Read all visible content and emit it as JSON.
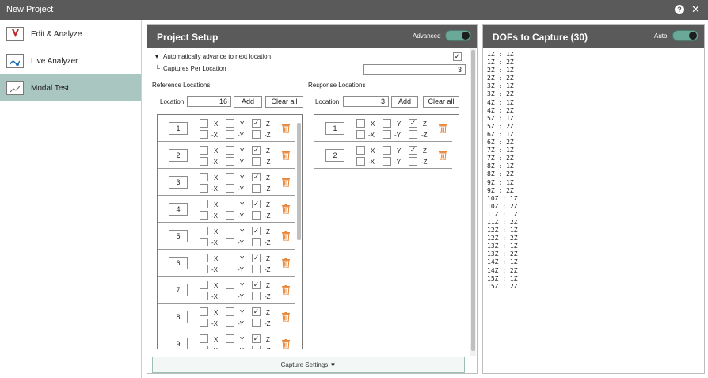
{
  "window": {
    "title": "New Project",
    "help_label": "?",
    "close_label": "✕"
  },
  "nav": {
    "items": [
      {
        "label": "Edit & Analyze",
        "icon": "edit-analyze-icon",
        "active": false
      },
      {
        "label": "Live Analyzer",
        "icon": "live-analyzer-icon",
        "active": false
      },
      {
        "label": "Modal Test",
        "icon": "modal-test-icon",
        "active": true
      }
    ]
  },
  "setup": {
    "title": "Project Setup",
    "advanced_label": "Advanced",
    "advanced_on": true,
    "auto_advance_label": "Automatically advance to next location",
    "auto_advance_checked": true,
    "captures_label": "Captures Per Location",
    "captures_value": "3",
    "reference": {
      "title": "Reference Locations",
      "location_label": "Location",
      "location_value": "16",
      "add_label": "Add",
      "clear_label": "Clear all",
      "rows": [
        "1",
        "2",
        "3",
        "4",
        "5",
        "6",
        "7",
        "8",
        "9"
      ]
    },
    "response": {
      "title": "Response Locations",
      "location_label": "Location",
      "location_value": "3",
      "add_label": "Add",
      "clear_label": "Clear all",
      "rows": [
        "1",
        "2"
      ]
    },
    "axis": {
      "x": "X",
      "y": "Y",
      "z": "Z",
      "nx": "-X",
      "ny": "-Y",
      "nz": "-Z"
    },
    "capture_settings_label": "Capture Settings ▼"
  },
  "dofs": {
    "title": "DOFs to Capture  (30)",
    "auto_label": "Auto",
    "auto_on": true,
    "items": [
      "1Z : 1Z",
      "1Z : 2Z",
      "2Z : 1Z",
      "2Z : 2Z",
      "3Z : 1Z",
      "3Z : 2Z",
      "4Z : 1Z",
      "4Z : 2Z",
      "5Z : 1Z",
      "5Z : 2Z",
      "6Z : 1Z",
      "6Z : 2Z",
      "7Z : 1Z",
      "7Z : 2Z",
      "8Z : 1Z",
      "8Z : 2Z",
      "9Z : 1Z",
      "9Z : 2Z",
      "10Z : 1Z",
      "10Z : 2Z",
      "11Z : 1Z",
      "11Z : 2Z",
      "12Z : 1Z",
      "12Z : 2Z",
      "13Z : 1Z",
      "13Z : 2Z",
      "14Z : 1Z",
      "14Z : 2Z",
      "15Z : 1Z",
      "15Z : 2Z"
    ]
  },
  "colors": {
    "accent": "#a9c6c0",
    "header": "#5a5a5a",
    "toggle": "#6aa897",
    "trash": "#e8873a"
  }
}
